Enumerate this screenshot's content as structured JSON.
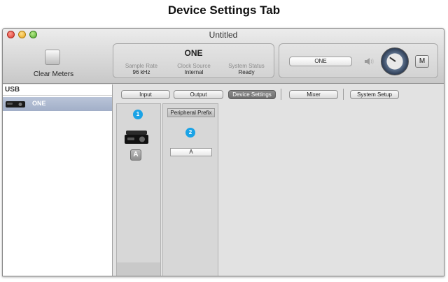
{
  "page": {
    "heading": "Device Settings Tab"
  },
  "window": {
    "title": "Untitled"
  },
  "toolbar": {
    "clear_meters_label": "Clear Meters",
    "device_name": "ONE",
    "info": [
      {
        "label": "Sample Rate",
        "value": "96 kHz"
      },
      {
        "label": "Clock Source",
        "value": "Internal"
      },
      {
        "label": "System Status",
        "value": "Ready"
      }
    ],
    "device_selector": "ONE",
    "mute_label": "M"
  },
  "sidebar": {
    "header": "USB",
    "items": [
      {
        "label": "ONE",
        "icon": "audio-device-icon"
      }
    ]
  },
  "tabs": [
    {
      "label": "Input",
      "active": false
    },
    {
      "label": "Output",
      "active": false
    },
    {
      "label": "Device Settings",
      "active": true
    },
    {
      "label": "Mixer",
      "active": false
    },
    {
      "label": "System Setup",
      "active": false
    }
  ],
  "device_column": {
    "badge": "1",
    "letter": "A"
  },
  "peripheral_column": {
    "header": "Peripheral Prefix",
    "badge": "2",
    "value": "A"
  },
  "colors": {
    "badge_blue": "#1aa3e6",
    "selection": "#a2afc8",
    "active_tab": "#7a7a7a"
  }
}
